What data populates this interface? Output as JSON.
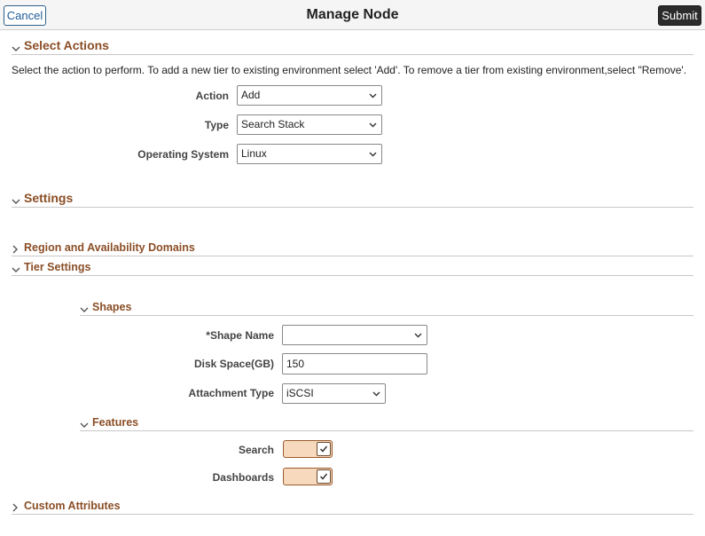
{
  "header": {
    "title": "Manage Node",
    "cancel_label": "Cancel",
    "submit_label": "Submit"
  },
  "select_actions": {
    "title": "Select Actions",
    "description": "Select the action to perform. To add a new tier to existing environment select 'Add'. To remove a tier from existing environment,select \"Remove'.",
    "action": {
      "label": "Action",
      "value": "Add"
    },
    "type": {
      "label": "Type",
      "value": "Search Stack"
    },
    "os": {
      "label": "Operating System",
      "value": "Linux"
    }
  },
  "settings": {
    "title": "Settings",
    "region": {
      "title": "Region and Availability Domains",
      "expanded": false
    },
    "tier": {
      "title": "Tier Settings",
      "shapes": {
        "title": "Shapes",
        "shape_name": {
          "label": "*Shape Name",
          "value": ""
        },
        "disk_space": {
          "label": "Disk Space(GB)",
          "value": "150"
        },
        "attachment": {
          "label": "Attachment Type",
          "value": "iSCSI"
        }
      },
      "features": {
        "title": "Features",
        "search": {
          "label": "Search",
          "checked": true
        },
        "dashboards": {
          "label": "Dashboards",
          "checked": true
        }
      }
    },
    "custom": {
      "title": "Custom Attributes",
      "expanded": false
    }
  },
  "colors": {
    "section_title": "#8a4e26",
    "toggle_fill": "#f7d9bd",
    "toggle_border": "#9a5a2e",
    "submit_bg": "#2b2b2b",
    "cancel_text": "#1f5b99"
  }
}
